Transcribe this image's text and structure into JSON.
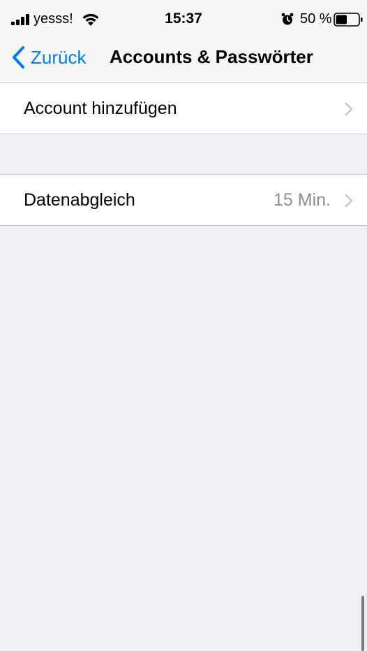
{
  "status_bar": {
    "carrier": "yesss!",
    "time": "15:37",
    "battery_percent": "50 %",
    "battery_level": 0.5,
    "icons": [
      "signal-icon",
      "wifi-icon",
      "alarm-icon",
      "battery-icon"
    ]
  },
  "nav": {
    "back_label": "Zurück",
    "title": "Accounts & Passwörter"
  },
  "rows": {
    "add_account": {
      "label": "Account hinzufügen"
    },
    "data_sync": {
      "label": "Datenabgleich",
      "value": "15 Min."
    }
  },
  "colors": {
    "accent": "#007aff",
    "background": "#efeff4",
    "secondary_text": "#8e8e93",
    "separator": "#c8c7cc",
    "chevron": "#c7c7cc"
  }
}
